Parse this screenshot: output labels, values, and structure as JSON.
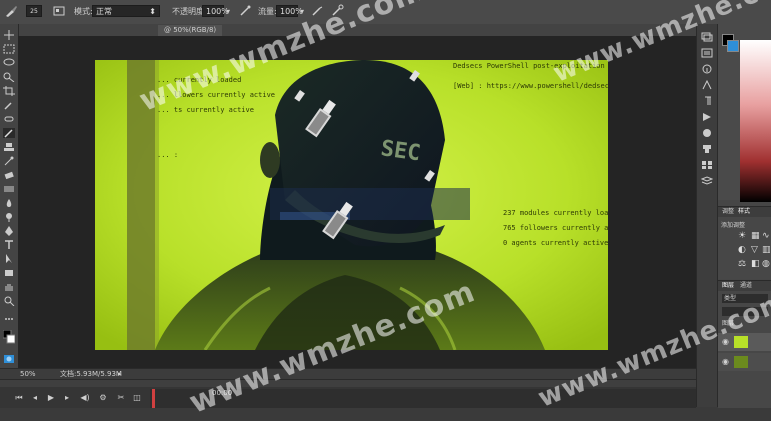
{
  "options_bar": {
    "brush_size": "25",
    "mode_label": "模式:",
    "mode_value": "正常",
    "opacity_label": "不透明度:",
    "opacity_value": "100%",
    "flow_label": "流量:",
    "flow_value": "100%"
  },
  "document_tab": {
    "title": "@ 50%(RGB/8)"
  },
  "status_bar": {
    "zoom": "50%",
    "doc_info": "文档:5.93M/5.93M"
  },
  "timeline": {
    "time_label": "00:00"
  },
  "artwork": {
    "terminal_lines_left": [
      "... currently loaded",
      "... llowers currently active",
      "... ts currently active",
      "... :"
    ],
    "terminal_lines_top": [
      "Dedsecs PowerShell post-exploitation",
      "[Web] : https://www.powershell/dedsec"
    ],
    "terminal_lines_bottom": [
      "237  modules  currently loaded",
      "765  followers  currently active",
      "0    agents  currently active"
    ],
    "cap_text": "SEC"
  },
  "right_panels": {
    "panel_tabs": [
      "调整",
      "样式"
    ],
    "adjust_label": "添加调整",
    "layers_tabs": [
      "图层",
      "通道"
    ],
    "layer_kind": "类型",
    "layer_name": "图层"
  },
  "watermark": {
    "text": "www.wmzhe.com"
  },
  "colors": {
    "artwork_bg": "#b8e029",
    "accent_blue": "#2f8fd8",
    "panel_bg": "#464646"
  }
}
